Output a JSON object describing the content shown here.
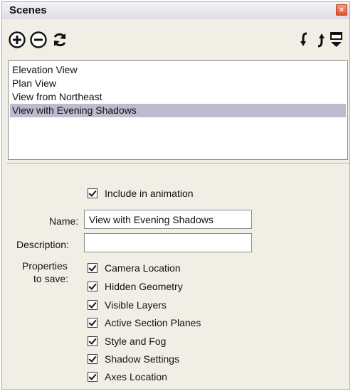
{
  "panel": {
    "title": "Scenes",
    "close_label": "×"
  },
  "toolbar": {
    "add_icon": "plus-circle-icon",
    "remove_icon": "minus-circle-icon",
    "update_icon": "refresh-icon",
    "move_down_icon": "move-down-arrow-icon",
    "move_up_icon": "move-up-arrow-icon",
    "details_icon": "show-details-icon"
  },
  "scenes": [
    {
      "label": "Elevation View",
      "selected": false
    },
    {
      "label": "Plan View",
      "selected": false
    },
    {
      "label": "View from Northeast",
      "selected": false
    },
    {
      "label": "View with Evening Shadows",
      "selected": true
    }
  ],
  "details": {
    "include_animation": {
      "label": "Include in animation",
      "checked": true
    },
    "name_label": "Name:",
    "name_value": "View with Evening Shadows",
    "description_label": "Description:",
    "description_value": "",
    "properties_label_line1": "Properties",
    "properties_label_line2": "to save:",
    "properties": [
      {
        "label": "Camera Location",
        "checked": true
      },
      {
        "label": "Hidden Geometry",
        "checked": true
      },
      {
        "label": "Visible Layers",
        "checked": true
      },
      {
        "label": "Active Section Planes",
        "checked": true
      },
      {
        "label": "Style and Fog",
        "checked": true
      },
      {
        "label": "Shadow Settings",
        "checked": true
      },
      {
        "label": "Axes Location",
        "checked": true
      }
    ]
  },
  "colors": {
    "panel_bg": "#f1efe5",
    "selection": "#bcbcce",
    "close_button": "#e5502f"
  }
}
